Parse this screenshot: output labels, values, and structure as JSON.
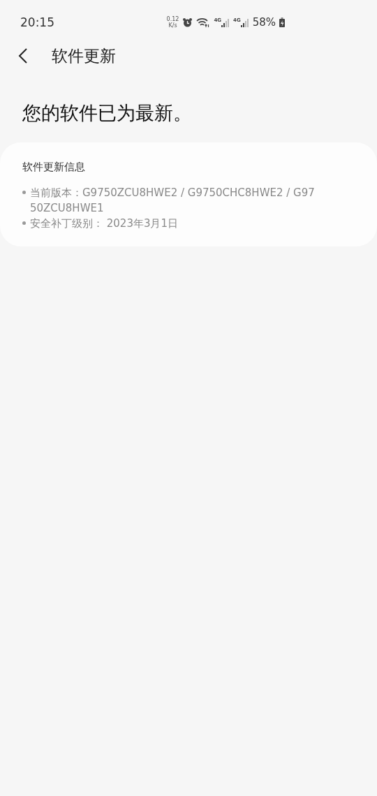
{
  "status_bar": {
    "time": "20:15",
    "net_speed": "0.12",
    "net_unit": "K/s",
    "net_types": [
      "4G",
      "4G"
    ],
    "battery": "58%"
  },
  "header": {
    "title": "软件更新"
  },
  "headline": "您的软件已为最新。",
  "info_card": {
    "title": "软件更新信息",
    "items": [
      {
        "text": "当前版本：G9750ZCU8HWE2 / G9750CHC8HWE2 / G9750ZCU8HWE1"
      },
      {
        "text": "安全补丁级别： 2023年3月1日"
      }
    ]
  }
}
